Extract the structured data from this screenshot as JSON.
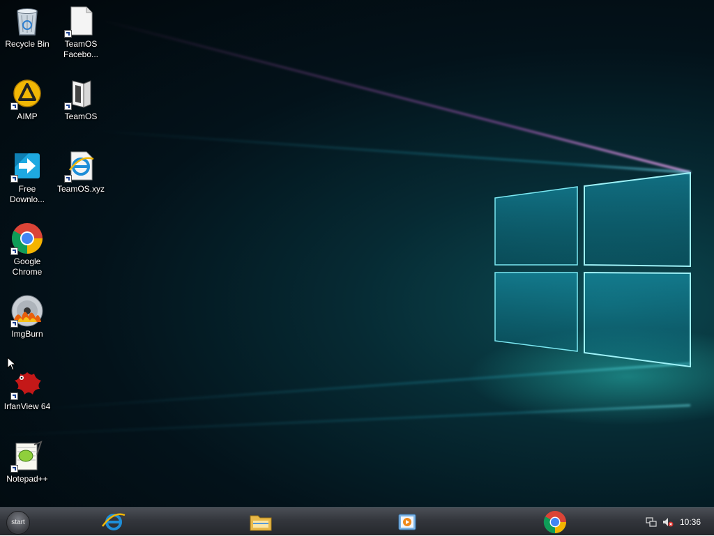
{
  "desktop": {
    "icons": [
      {
        "id": "recycle-bin",
        "label": "Recycle Bin",
        "icon": "recycle-bin-icon",
        "shortcut": false
      },
      {
        "id": "teamos-facebook",
        "label": "TeamOS Facebo...",
        "icon": "blank-file-icon",
        "shortcut": true
      },
      {
        "id": "aimp",
        "label": "AIMP",
        "icon": "aimp-icon",
        "shortcut": true
      },
      {
        "id": "teamos",
        "label": "TeamOS",
        "icon": "teamos-icon",
        "shortcut": true
      },
      {
        "id": "free-download",
        "label": "Free Downlo...",
        "icon": "free-download-manager-icon",
        "shortcut": true
      },
      {
        "id": "teamos-xyz",
        "label": "TeamOS.xyz",
        "icon": "internet-explorer-shortcut-icon",
        "shortcut": true
      },
      {
        "id": "google-chrome",
        "label": "Google Chrome",
        "icon": "chrome-icon",
        "shortcut": true
      },
      {
        "id": "imgburn",
        "label": "ImgBurn",
        "icon": "imgburn-icon",
        "shortcut": true
      },
      {
        "id": "irfanview",
        "label": "IrfanView 64",
        "icon": "irfanview-icon",
        "shortcut": true
      },
      {
        "id": "notepadpp",
        "label": "Notepad++",
        "icon": "notepadpp-icon",
        "shortcut": true
      }
    ]
  },
  "taskbar": {
    "start_label": "start",
    "pinned": [
      {
        "name": "internet-explorer",
        "icon": "internet-explorer-icon"
      },
      {
        "name": "file-explorer",
        "icon": "folder-icon"
      },
      {
        "name": "media-player",
        "icon": "media-player-icon"
      },
      {
        "name": "google-chrome",
        "icon": "chrome-icon"
      }
    ],
    "tray": {
      "network_icon": "network-icon",
      "volume_icon": "volume-muted-icon",
      "clock": "10:36"
    }
  },
  "colors": {
    "wallpaper_dark": "#02070b",
    "window_glow": "#5fe0ee",
    "ray_pink": "#d46ae0",
    "ray_cyan": "#2ec5e0",
    "taskbar": "#33363c"
  }
}
